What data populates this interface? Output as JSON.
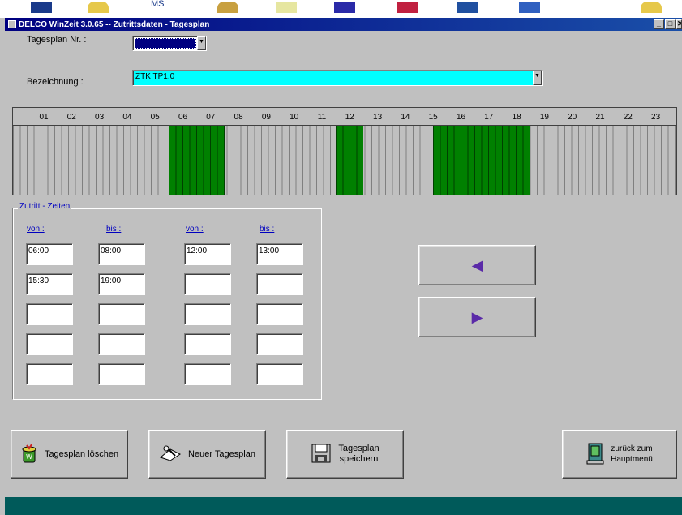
{
  "window": {
    "title": "DELCO WinZeit 3.0.65 -- Zutrittsdaten - Tagesplan",
    "min_glyph": "_",
    "max_glyph": "□",
    "close_glyph": "✕"
  },
  "desktop": {
    "partial_label": "MS"
  },
  "form": {
    "plan_nr_label": "Tagesplan Nr. :",
    "plan_nr_value": "",
    "bezeichnung_label": "Bezeichnung :",
    "bezeichnung_value": "ZTK TP1.0",
    "dropdown_glyph": "▼"
  },
  "timeline": {
    "hours": [
      "01",
      "02",
      "03",
      "04",
      "05",
      "06",
      "07",
      "08",
      "09",
      "10",
      "11",
      "12",
      "13",
      "14",
      "15",
      "16",
      "17",
      "18",
      "19",
      "20",
      "21",
      "22",
      "23"
    ],
    "active_ranges": [
      {
        "from": "06:00",
        "to": "08:00"
      },
      {
        "from": "12:00",
        "to": "13:00"
      },
      {
        "from": "15:30",
        "to": "19:00"
      }
    ],
    "active_color": "#008000"
  },
  "zeiten": {
    "group_title": "Zutritt - Zeiten",
    "col_von_1": "von :",
    "col_bis_1": "bis :",
    "col_von_2": "von :",
    "col_bis_2": "bis :",
    "rows": [
      {
        "von1": "06:00",
        "bis1": "08:00",
        "von2": "12:00",
        "bis2": "13:00"
      },
      {
        "von1": "15:30",
        "bis1": "19:00",
        "von2": "",
        "bis2": ""
      },
      {
        "von1": "",
        "bis1": "",
        "von2": "",
        "bis2": ""
      },
      {
        "von1": "",
        "bis1": "",
        "von2": "",
        "bis2": ""
      },
      {
        "von1": "",
        "bis1": "",
        "von2": "",
        "bis2": ""
      }
    ]
  },
  "nav": {
    "prev_glyph": "◀",
    "next_glyph": "▶",
    "arrow_color": "#5a2aa8"
  },
  "buttons": {
    "delete_label": "Tagesplan löschen",
    "new_label": "Neuer Tagesplan",
    "save_label_line1": "Tagesplan",
    "save_label_line2": "speichern",
    "back_label_line1": "zurück zum",
    "back_label_line2": "Hauptmenü"
  }
}
